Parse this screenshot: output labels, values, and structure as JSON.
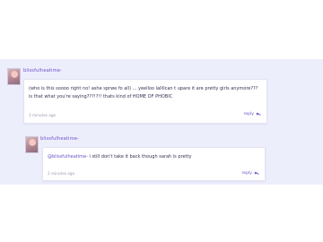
{
  "thread": {
    "comments": [
      {
        "author": "blissfulheatime-",
        "text_line1": "(who is this soooo right no! ashe sprwe fo all) ... yeelloo lalillcan t upare it are pretty girls anymore???",
        "text_line2": "is that what you're saying???!?!! thats kind of HOME OF PHOBIC",
        "time": "3 minutes ago",
        "reply_label": "reply"
      },
      {
        "author": "blissfulheatime-",
        "mention": "@blissfulheatime-",
        "text": " i still don't take it back though sarah is pretty",
        "time": "2 minutes ago",
        "reply_label": "reply"
      }
    ]
  },
  "colors": {
    "accent": "#6b52c8",
    "strip": "#edeefc",
    "muted": "#9a9ab0"
  }
}
